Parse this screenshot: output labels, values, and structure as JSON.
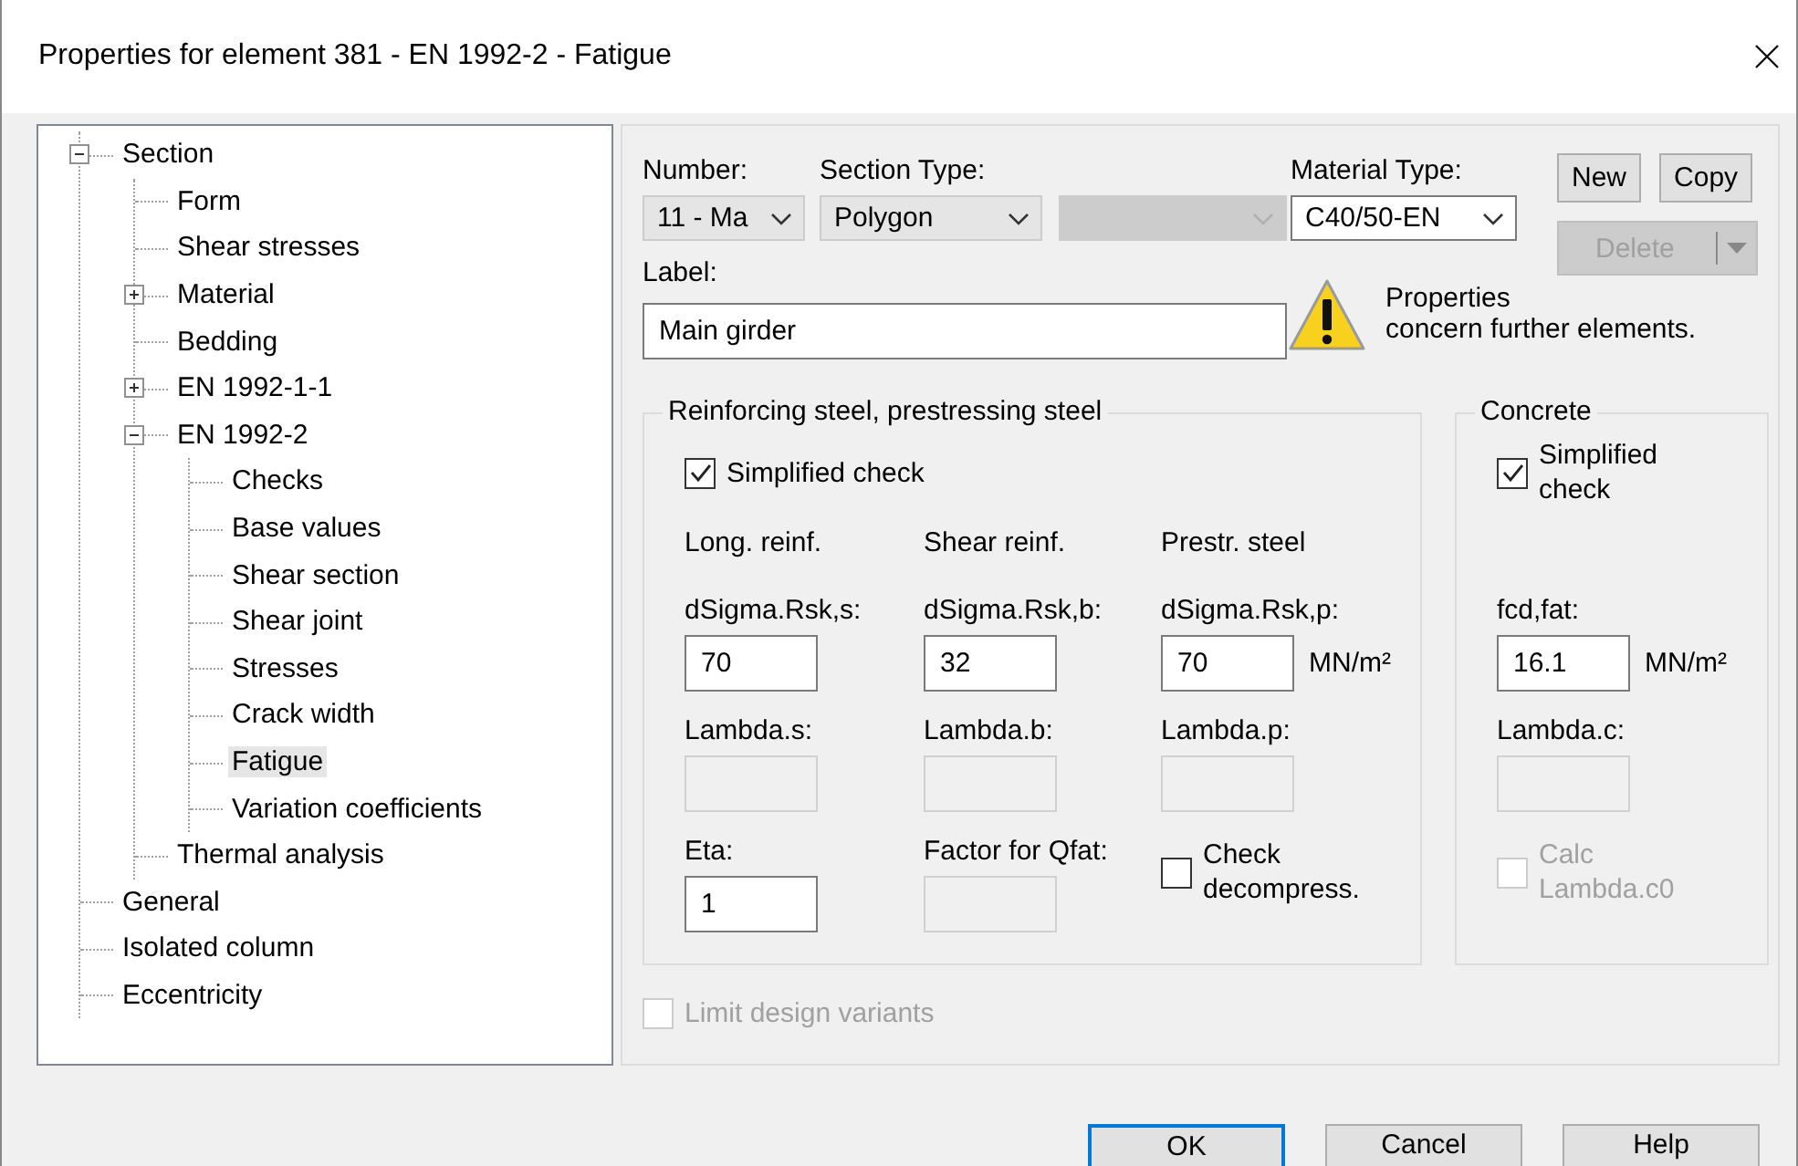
{
  "window": {
    "title": "Properties for element 381 - EN 1992-2 - Fatigue"
  },
  "tree": [
    {
      "label": "Section",
      "expanded": true,
      "selected": false,
      "children": [
        {
          "label": "Form",
          "selected": false
        },
        {
          "label": "Shear stresses",
          "selected": false
        },
        {
          "label": "Material",
          "expanded": false,
          "selected": false
        },
        {
          "label": "Bedding",
          "selected": false
        },
        {
          "label": "EN 1992-1-1",
          "expanded": false,
          "selected": false
        },
        {
          "label": "EN 1992-2",
          "expanded": true,
          "selected": false,
          "children": [
            {
              "label": "Checks",
              "selected": false
            },
            {
              "label": "Base values",
              "selected": false
            },
            {
              "label": "Shear section",
              "selected": false
            },
            {
              "label": "Shear joint",
              "selected": false
            },
            {
              "label": "Stresses",
              "selected": false
            },
            {
              "label": "Crack width",
              "selected": false
            },
            {
              "label": "Fatigue",
              "selected": true
            },
            {
              "label": "Variation coefficients",
              "selected": false
            }
          ]
        },
        {
          "label": "Thermal analysis",
          "selected": false
        }
      ]
    },
    {
      "label": "General",
      "selected": false
    },
    {
      "label": "Isolated column",
      "selected": false
    },
    {
      "label": "Eccentricity",
      "selected": false
    }
  ],
  "combos": [
    {
      "label": "Number:",
      "value": "11 - Ma",
      "kind": "readonly"
    },
    {
      "label": "Section Type:",
      "value": "Polygon",
      "kind": "readonly"
    },
    {
      "kind": "disabled"
    },
    {
      "label": "Material Type:",
      "value": "C40/50-EN",
      "kind": "editable"
    }
  ],
  "buttons": [
    {
      "label": "New",
      "kind": "plain",
      "disabled": false
    },
    {
      "label": "Copy",
      "kind": "plain",
      "disabled": false
    },
    {
      "label": "Delete",
      "kind": "split",
      "disabled": true
    }
  ],
  "label_field": {
    "label": "Label:",
    "value": "Main girder"
  },
  "warning": {
    "text": "Properties\nconcern further elements."
  },
  "groups": [
    {
      "title": "Reinforcing steel, prestressing steel",
      "check": {
        "label": "Simplified check",
        "checked": true,
        "disabled": false
      },
      "columns": [
        {
          "heading": "Long. reinf.",
          "items": [
            {
              "kind": "field",
              "label": "dSigma.Rsk,s:",
              "value": "70",
              "disabled": false
            },
            {
              "kind": "field",
              "label": "Lambda.s:",
              "disabled": true
            },
            {
              "kind": "field",
              "label": "Eta:",
              "value": "1",
              "disabled": false
            }
          ]
        },
        {
          "heading": "Shear reinf.",
          "items": [
            {
              "kind": "field",
              "label": "dSigma.Rsk,b:",
              "value": "32",
              "disabled": false
            },
            {
              "kind": "field",
              "label": "Lambda.b:",
              "disabled": true
            },
            {
              "kind": "field",
              "label": "Factor for Qfat:",
              "disabled": true
            }
          ]
        },
        {
          "heading": "Prestr. steel",
          "items": [
            {
              "kind": "field",
              "label": "dSigma.Rsk,p:",
              "value": "70",
              "unit": "MN/m²",
              "disabled": false
            },
            {
              "kind": "field",
              "label": "Lambda.p:",
              "disabled": true
            },
            {
              "kind": "check",
              "label": "Check decompress.",
              "checked": false,
              "disabled": false
            }
          ]
        }
      ]
    },
    {
      "title": "Concrete",
      "check": {
        "label": "Simplified check",
        "checked": true,
        "disabled": false
      },
      "columns": [
        {
          "items": [
            {
              "kind": "field",
              "label": "fcd,fat:",
              "value": "16.1",
              "unit": "MN/m²",
              "disabled": false
            },
            {
              "kind": "field",
              "label": "Lambda.c:",
              "disabled": true
            },
            {
              "kind": "check",
              "label": "Calc Lambda.c0",
              "checked": false,
              "disabled": true
            }
          ]
        }
      ]
    }
  ],
  "limit_check": {
    "label": "Limit design variants",
    "checked": false,
    "disabled": true
  },
  "dialog_buttons": [
    {
      "label": "OK",
      "default": true
    },
    {
      "label": "Cancel",
      "default": false
    },
    {
      "label": "Help",
      "default": false
    }
  ]
}
